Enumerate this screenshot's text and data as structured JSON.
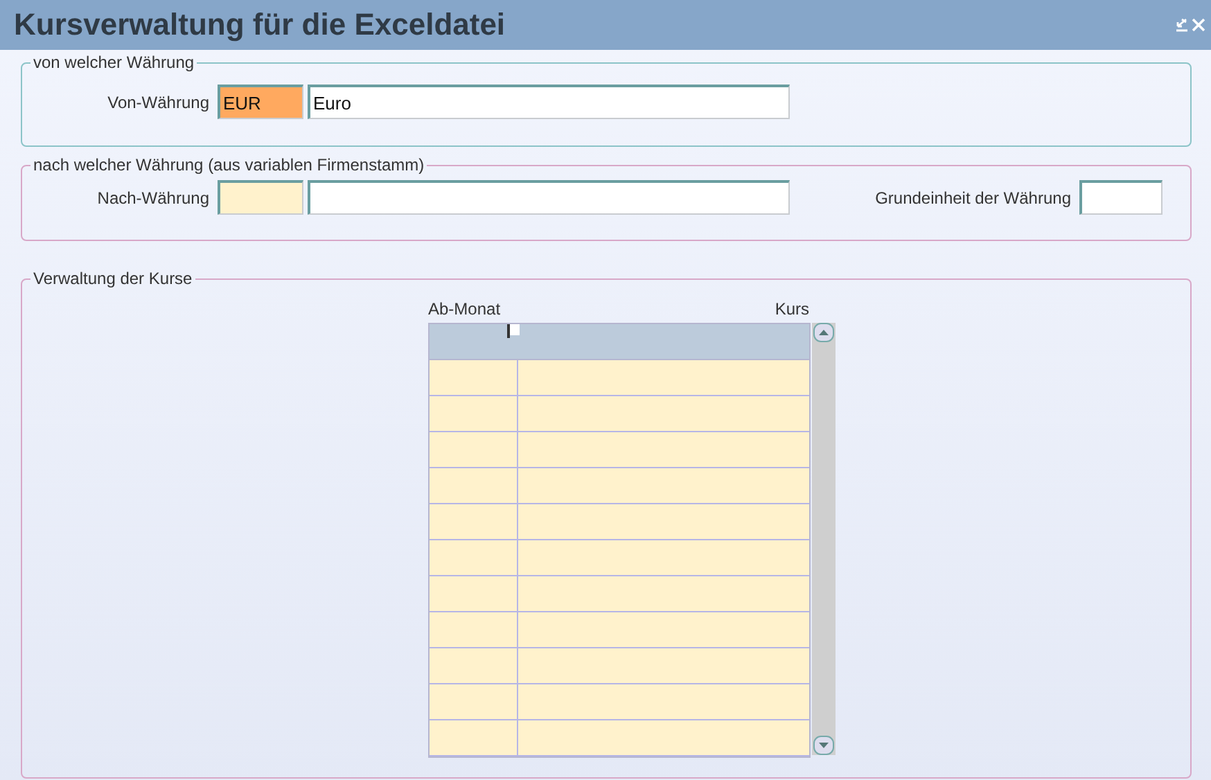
{
  "window": {
    "title": "Kursverwaltung für die Exceldatei"
  },
  "sections": [
    {
      "legend": "von welcher Währung",
      "fields": [
        {
          "label": "Von-Währung",
          "code": "EUR",
          "name": "Euro",
          "focused": true
        }
      ]
    },
    {
      "legend": "nach welcher Währung (aus variablen Firmenstamm)",
      "fields": [
        {
          "label": "Nach-Währung",
          "focused": false
        }
      ],
      "unit_field": {
        "label": "Grundeinheit der Währung"
      }
    }
  ],
  "rates": {
    "legend": "Verwaltung der Kurse",
    "columns": [
      "Ab-Monat",
      "Kurs"
    ]
  }
}
